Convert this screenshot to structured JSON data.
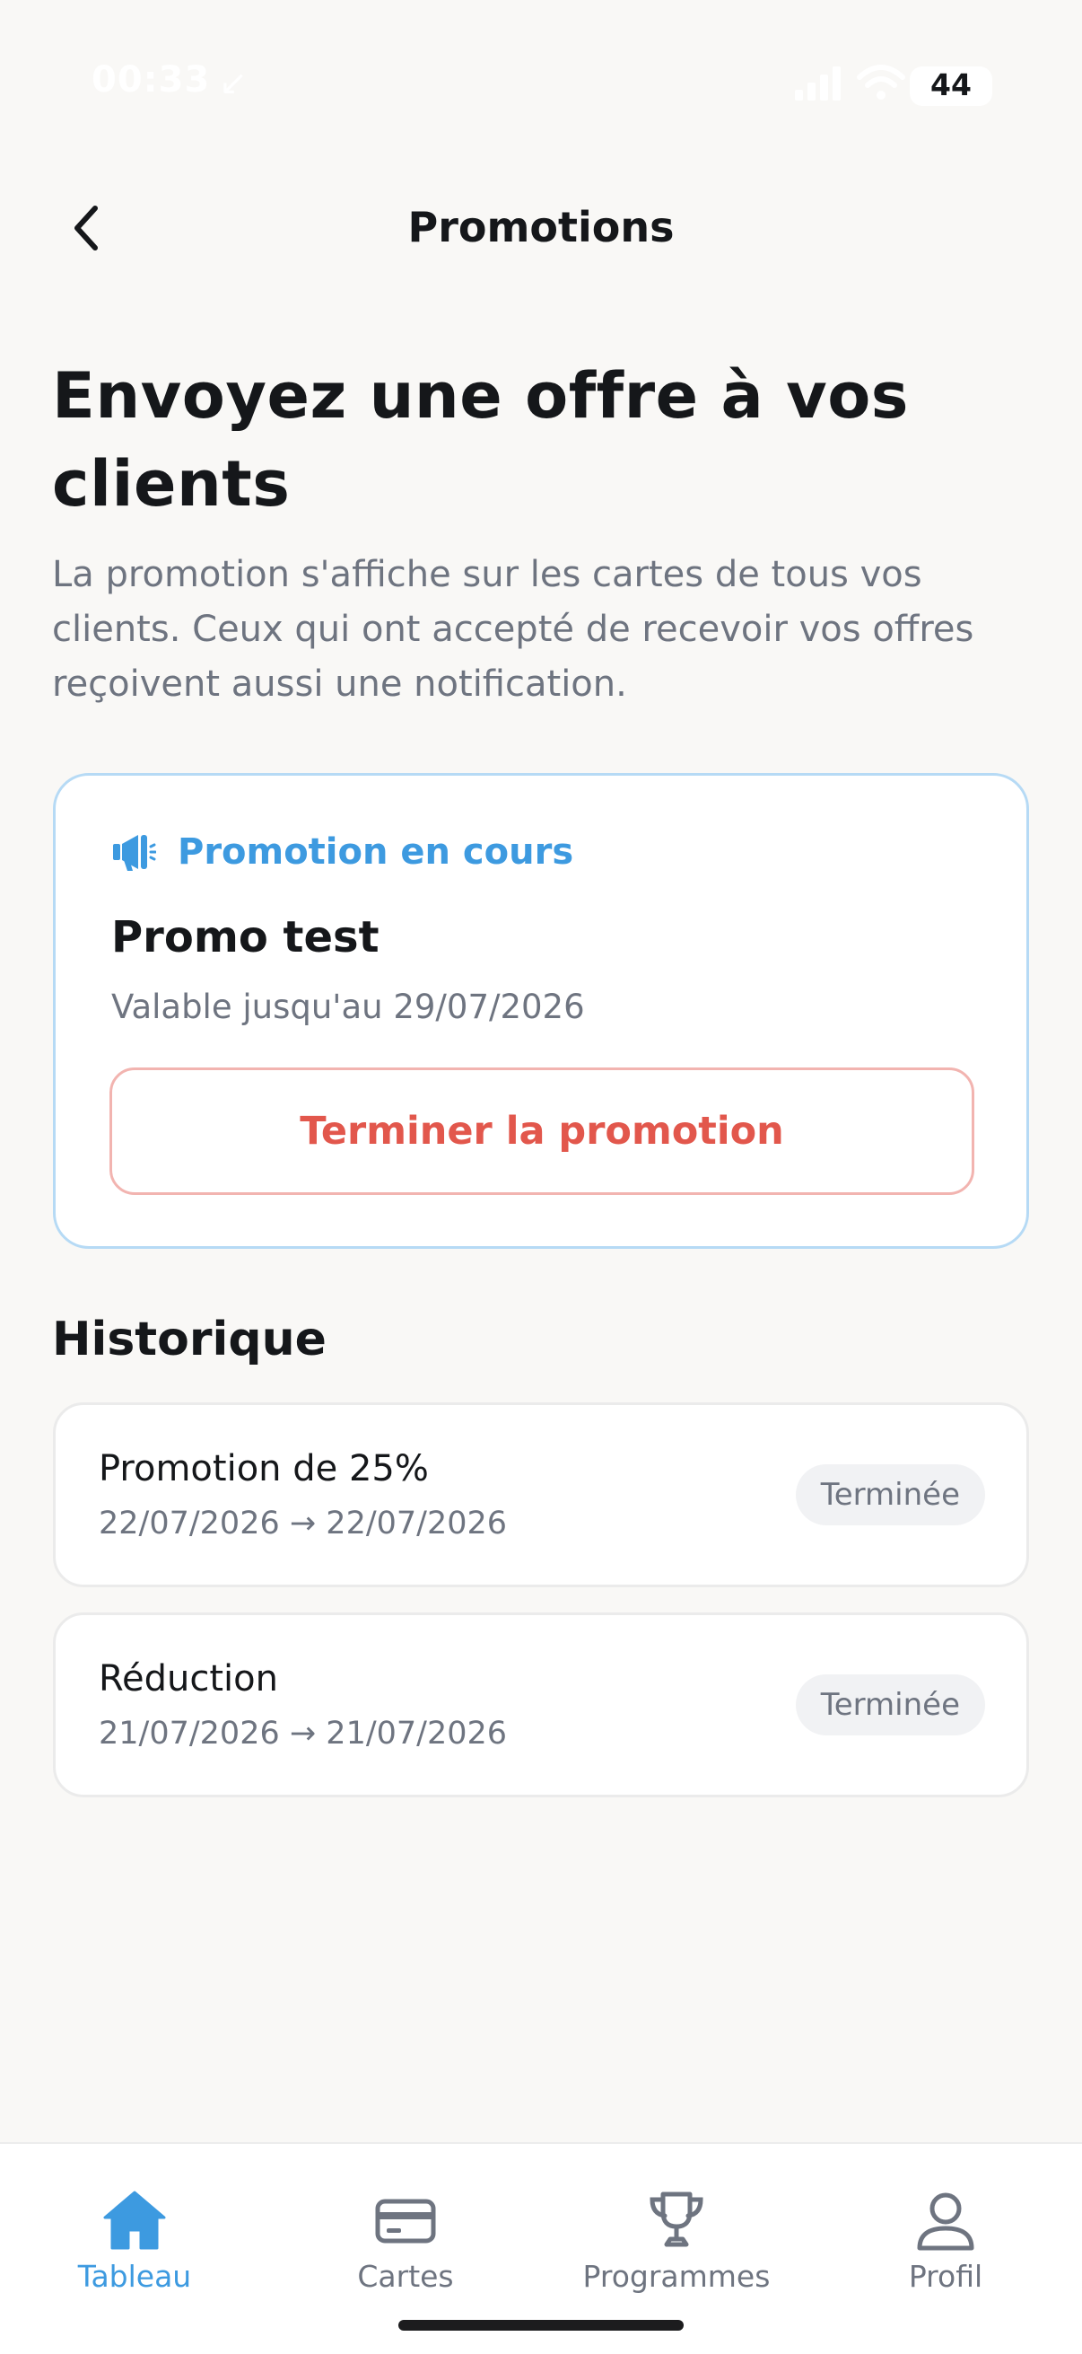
{
  "status_bar": {
    "time": "00:33",
    "location_arrow": "↙",
    "battery": "44",
    "icons": [
      "signal-icon",
      "wifi-icon",
      "battery-icon"
    ]
  },
  "header": {
    "title": "Promotions",
    "back_icon": "chevron-left-icon"
  },
  "intro": {
    "headline": "Envoyez une offre à vos clients",
    "subtitle": "La promotion s'affiche sur les cartes de tous vos clients. Ceux qui ont accepté de recevoir vos offres reçoivent aussi une notification."
  },
  "active_promotion": {
    "label": "Promotion en cours",
    "icon": "megaphone-icon",
    "name": "Promo test",
    "validity": "Valable jusqu'au 29/07/2026",
    "end_button": "Terminer la promotion"
  },
  "history": {
    "title": "Historique",
    "items": [
      {
        "name": "Promotion de 25%",
        "dates": "22/07/2026 → 22/07/2026",
        "status": "Terminée"
      },
      {
        "name": "Réduction",
        "dates": "21/07/2026 → 21/07/2026",
        "status": "Terminée"
      }
    ]
  },
  "tab_bar": {
    "tabs": [
      {
        "label": "Tableau",
        "icon": "home-icon",
        "active": true
      },
      {
        "label": "Cartes",
        "icon": "card-icon",
        "active": false
      },
      {
        "label": "Programmes",
        "icon": "trophy-icon",
        "active": false
      },
      {
        "label": "Profil",
        "icon": "user-icon",
        "active": false
      }
    ]
  },
  "colors": {
    "accent": "#3d9ae0",
    "danger": "#e2574c",
    "background": "#f9f8f6",
    "muted_text": "#6e7480"
  }
}
